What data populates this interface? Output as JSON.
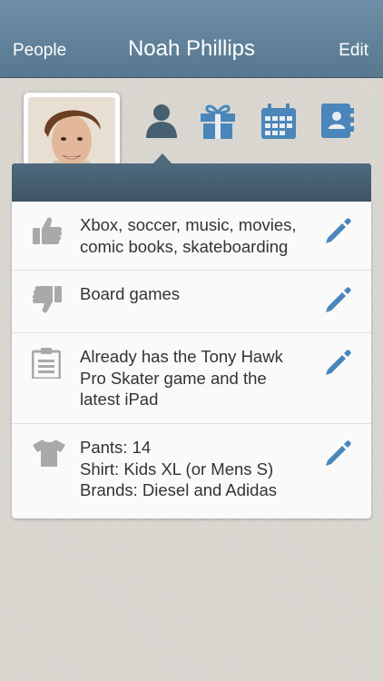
{
  "nav": {
    "left_label": "People",
    "title": "Noah Phillips",
    "right_label": "Edit"
  },
  "colors": {
    "nav_background": "#6282a0",
    "accent": "#4a86ba",
    "header_bar": "#46606f"
  },
  "tabs": [
    {
      "icon": "person-icon",
      "selected": true
    },
    {
      "icon": "gift-icon",
      "selected": false
    },
    {
      "icon": "calendar-icon",
      "selected": false
    },
    {
      "icon": "address-book-icon",
      "selected": false
    }
  ],
  "rows": [
    {
      "icon": "thumbs-up-icon",
      "lines": [
        "Xbox, soccer, music, movies,",
        "comic books, skateboarding"
      ]
    },
    {
      "icon": "thumbs-down-icon",
      "lines": [
        "Board games"
      ]
    },
    {
      "icon": "clipboard-icon",
      "lines": [
        "Already has the Tony Hawk",
        "Pro Skater game and the",
        "latest iPad"
      ]
    },
    {
      "icon": "tshirt-icon",
      "lines": [
        "Pants: 14",
        "Shirt: Kids XL (or Mens S)",
        "Brands: Diesel and Adidas"
      ]
    }
  ]
}
